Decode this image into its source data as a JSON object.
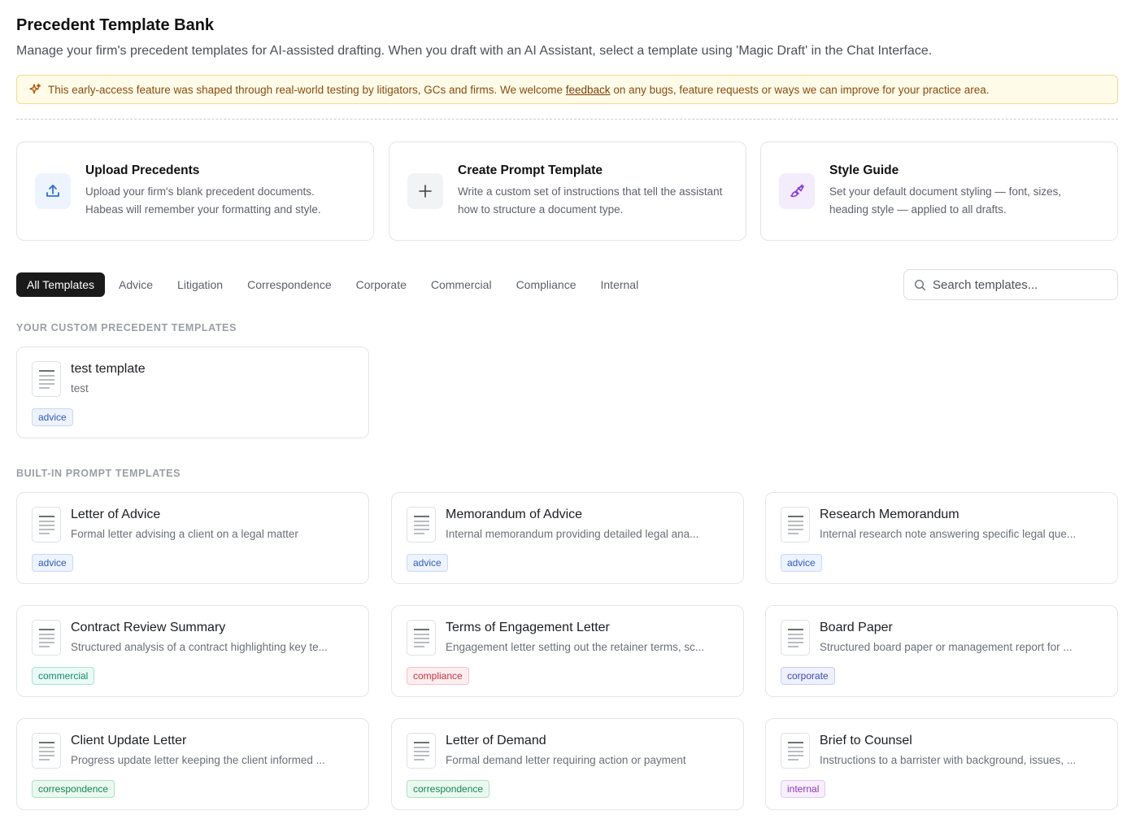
{
  "header": {
    "title": "Precedent Template Bank",
    "subtitle": "Manage your firm's precedent templates for AI-assisted drafting. When you draft with an AI Assistant, select a template using 'Magic Draft' in the Chat Interface."
  },
  "banner": {
    "text_before": "This early-access feature was shaped through real-world testing by litigators, GCs and firms. We welcome ",
    "link_text": "feedback",
    "text_after": " on any bugs, feature requests or ways we can improve for your practice area.",
    "icon": "sparkle-icon",
    "color": "#fefbe8"
  },
  "actions": [
    {
      "title": "Upload Precedents",
      "desc": "Upload your firm's blank precedent documents. Habeas will remember your formatting and style.",
      "icon": "upload-icon"
    },
    {
      "title": "Create Prompt Template",
      "desc": "Write a custom set of instructions that tell the assistant how to structure a document type.",
      "icon": "plus-icon"
    },
    {
      "title": "Style Guide",
      "desc": "Set your default document styling — font, sizes, heading style — applied to all drafts.",
      "icon": "paintbrush-icon"
    }
  ],
  "tabs": [
    "All Templates",
    "Advice",
    "Litigation",
    "Correspondence",
    "Corporate",
    "Commercial",
    "Compliance",
    "Internal"
  ],
  "active_tab": "All Templates",
  "search": {
    "placeholder": "Search templates..."
  },
  "custom_section": {
    "heading": "YOUR CUSTOM PRECEDENT TEMPLATES",
    "items": [
      {
        "title": "test template",
        "desc": "test",
        "tag": "advice"
      }
    ]
  },
  "builtin_section": {
    "heading": "BUILT-IN PROMPT TEMPLATES",
    "items": [
      {
        "title": "Letter of Advice",
        "desc": "Formal letter advising a client on a legal matter",
        "tag": "advice"
      },
      {
        "title": "Memorandum of Advice",
        "desc": "Internal memorandum providing detailed legal ana...",
        "tag": "advice"
      },
      {
        "title": "Research Memorandum",
        "desc": "Internal research note answering specific legal que...",
        "tag": "advice"
      },
      {
        "title": "Contract Review Summary",
        "desc": "Structured analysis of a contract highlighting key te...",
        "tag": "commercial"
      },
      {
        "title": "Terms of Engagement Letter",
        "desc": "Engagement letter setting out the retainer terms, sc...",
        "tag": "compliance"
      },
      {
        "title": "Board Paper",
        "desc": "Structured board paper or management report for ...",
        "tag": "corporate"
      },
      {
        "title": "Client Update Letter",
        "desc": "Progress update letter keeping the client informed ...",
        "tag": "correspondence"
      },
      {
        "title": "Letter of Demand",
        "desc": "Formal demand letter requiring action or payment",
        "tag": "correspondence"
      },
      {
        "title": "Brief to Counsel",
        "desc": "Instructions to a barrister with background, issues, ...",
        "tag": "internal"
      }
    ]
  }
}
